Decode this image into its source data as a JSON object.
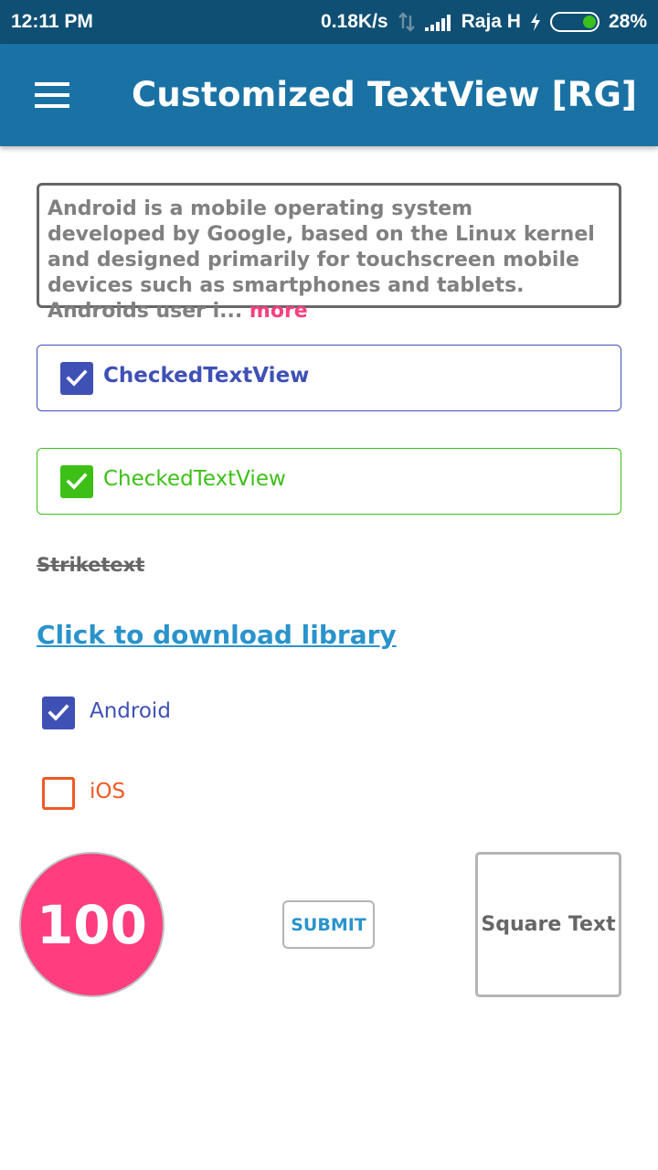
{
  "status_bar": {
    "time": "12:11 PM",
    "network_speed": "0.18K/s",
    "carrier": "Raja H",
    "battery": "28%",
    "icons": [
      "data-updown-icon",
      "signal-icon",
      "charging-bolt-icon",
      "battery-icon"
    ]
  },
  "app_bar": {
    "menu_icon": "hamburger-menu-icon",
    "title": "Customized TextView [RG]"
  },
  "description": {
    "text": "Android is a mobile operating system developed by Google, based on the Linux kernel and designed primarily for touchscreen mobile devices such as smartphones and tablets. Androids user i...",
    "more_label": "more",
    "more_color": "#ff3f7f"
  },
  "checked_views": [
    {
      "label": "CheckedTextView",
      "checked": true,
      "color": "#3f51b5"
    },
    {
      "label": "CheckedTextView",
      "checked": true,
      "color": "#3cc017"
    }
  ],
  "strike_text": "Striketext",
  "download_link": "Click to download library",
  "options": [
    {
      "label": "Android",
      "checked": true,
      "color": "#3f51b5"
    },
    {
      "label": "iOS",
      "checked": false,
      "color": "#ee5a24"
    }
  ],
  "circle_text": "100",
  "submit_label": "SUBMIT",
  "square_text": "Square Text",
  "colors": {
    "status_bar": "#0f4f73",
    "app_bar": "#1a72a4",
    "pink": "#ff3d7f",
    "link_blue": "#2a93cc"
  }
}
